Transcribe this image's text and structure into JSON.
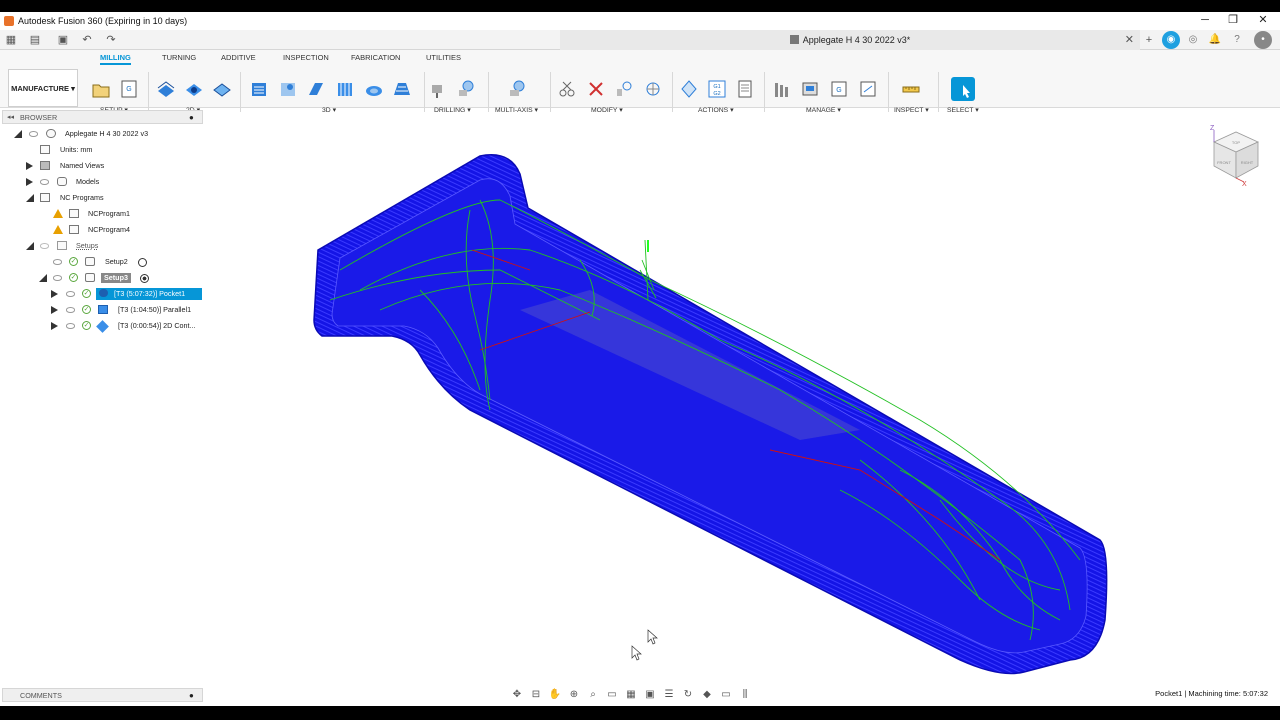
{
  "window": {
    "title": "Autodesk Fusion 360 (Expiring in 10 days)",
    "minimize": "─",
    "restore": "❐",
    "close": "✕"
  },
  "document": {
    "tab_title": "Applegate H 4 30 2022 v3*",
    "close_glyph": "✕"
  },
  "ribbon": {
    "tabs": [
      "MILLING",
      "TURNING",
      "ADDITIVE",
      "INSPECTION",
      "FABRICATION",
      "UTILITIES"
    ],
    "active_tab": "MILLING",
    "workspace": "MANUFACTURE ▾",
    "groups": [
      "SETUP ▾",
      "2D ▾",
      "3D ▾",
      "DRILLING ▾",
      "MULTI-AXIS ▾",
      "MODIFY ▾",
      "ACTIONS ▾",
      "MANAGE ▾",
      "INSPECT ▾",
      "SELECT ▾"
    ],
    "actions_code_label": "G1\nG2"
  },
  "browser": {
    "title": "BROWSER",
    "items": [
      {
        "label": "Applegate H 4 30 2022 v3"
      },
      {
        "label": "Units: mm"
      },
      {
        "label": "Named Views"
      },
      {
        "label": "Models"
      },
      {
        "label": "NC Programs"
      },
      {
        "label": "NCProgram1"
      },
      {
        "label": "NCProgram4"
      },
      {
        "label": "Setups"
      },
      {
        "label": "Setup2"
      },
      {
        "label": "Setup3"
      },
      {
        "label": "[T3 (5:07:32)] Pocket1"
      },
      {
        "label": "[T3 (1:04:50)] Parallel1"
      },
      {
        "label": "[T3 (0:00:54)] 2D Cont..."
      }
    ]
  },
  "comments": {
    "title": "COMMENTS"
  },
  "status": {
    "text": "Pocket1 | Machining time: 5:07:32"
  },
  "viewcube": {
    "axis_z": "Z",
    "axis_x": "X",
    "top": "TOP",
    "front": "FRONT",
    "right": "RIGHT"
  },
  "colors": {
    "accent": "#0696d7",
    "toolpath_blue": "#1010e0",
    "toolpath_green": "#22c022",
    "toolpath_red": "#d01010",
    "warning": "#e8a000"
  }
}
